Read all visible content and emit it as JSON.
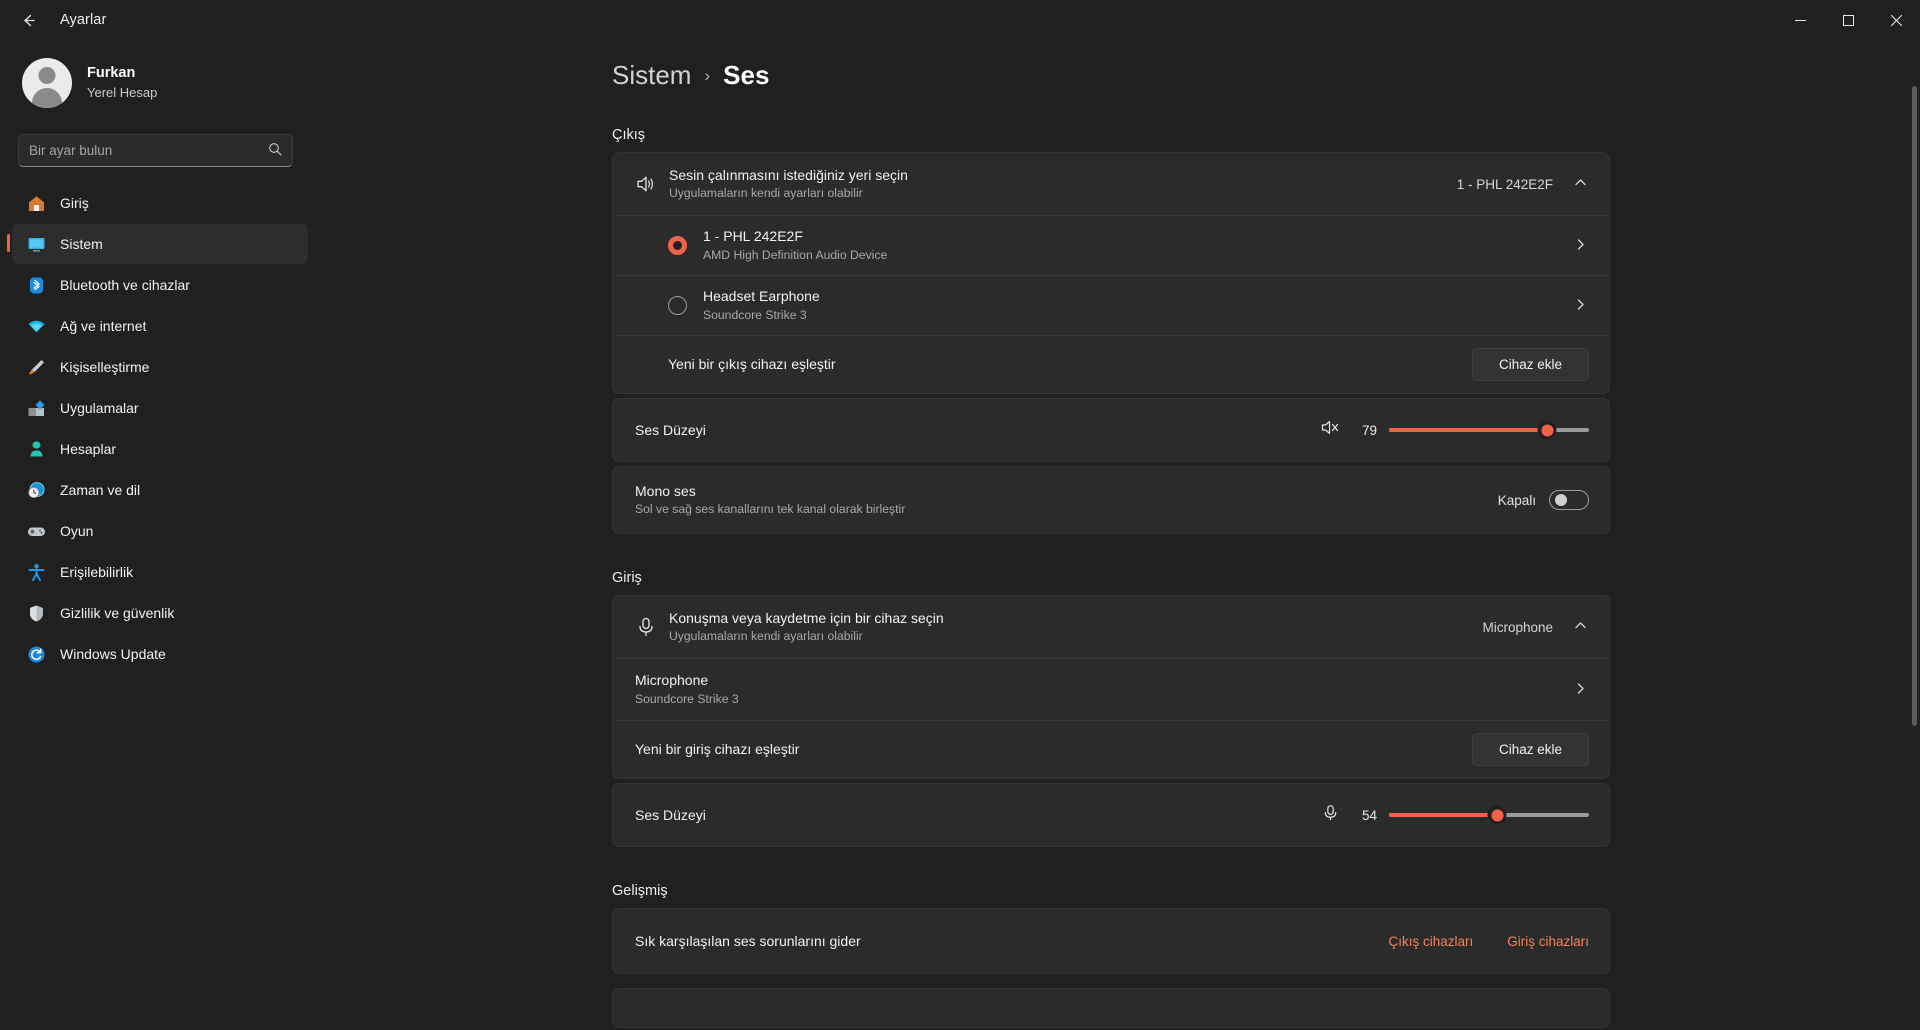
{
  "window": {
    "title": "Ayarlar",
    "back_icon": "back-arrow-icon",
    "minimize": "─",
    "maximize": "☐",
    "close": "✕"
  },
  "account": {
    "name": "Furkan",
    "type": "Yerel Hesap"
  },
  "search": {
    "placeholder": "Bir ayar bulun",
    "value": "",
    "icon": "search-icon"
  },
  "sidebar": {
    "items": [
      {
        "label": "Giriş",
        "icon": "home-icon",
        "active": false
      },
      {
        "label": "Sistem",
        "icon": "system-display-icon",
        "active": true
      },
      {
        "label": "Bluetooth ve cihazlar",
        "icon": "bluetooth-icon",
        "active": false
      },
      {
        "label": "Ağ ve internet",
        "icon": "wifi-icon",
        "active": false
      },
      {
        "label": "Kişiselleştirme",
        "icon": "paintbrush-icon",
        "active": false
      },
      {
        "label": "Uygulamalar",
        "icon": "apps-icon",
        "active": false
      },
      {
        "label": "Hesaplar",
        "icon": "account-person-icon",
        "active": false
      },
      {
        "label": "Zaman ve dil",
        "icon": "clock-globe-icon",
        "active": false
      },
      {
        "label": "Oyun",
        "icon": "gamepad-icon",
        "active": false
      },
      {
        "label": "Erişilebilirlik",
        "icon": "accessibility-person-icon",
        "active": false
      },
      {
        "label": "Gizlilik ve güvenlik",
        "icon": "shield-icon",
        "active": false
      },
      {
        "label": "Windows Update",
        "icon": "update-refresh-icon",
        "active": false
      }
    ]
  },
  "breadcrumb": {
    "parent": "Sistem",
    "separator": "›",
    "current": "Ses"
  },
  "sections": {
    "output": {
      "title": "Çıkış",
      "chooser": {
        "icon": "speaker-icon",
        "title": "Sesin çalınmasını istediğiniz yeri seçin",
        "subtitle": "Uygulamaların kendi ayarları olabilir",
        "value": "1 - PHL 242E2F",
        "chevron": "⌃"
      },
      "devices": [
        {
          "name": "1 - PHL 242E2F",
          "desc": "AMD High Definition Audio Device",
          "selected": true,
          "chevron": "›"
        },
        {
          "name": "Headset Earphone",
          "desc": "Soundcore Strike 3",
          "selected": false,
          "chevron": "›"
        }
      ],
      "pair": {
        "label": "Yeni bir çıkış cihazı eşleştir",
        "button": "Cihaz ekle"
      },
      "volume": {
        "label": "Ses Düzeyi",
        "value": 79,
        "icon": "speaker-muted-icon"
      },
      "mono": {
        "title": "Mono ses",
        "subtitle": "Sol ve sağ ses kanallarını tek kanal olarak birleştir",
        "state_label": "Kapalı",
        "on": false
      }
    },
    "input": {
      "title": "Giriş",
      "chooser": {
        "icon": "microphone-icon",
        "title": "Konuşma veya kaydetme için bir cihaz seçin",
        "subtitle": "Uygulamaların kendi ayarları olabilir",
        "value": "Microphone",
        "chevron": "⌃"
      },
      "devices": [
        {
          "name": "Microphone",
          "desc": "Soundcore Strike 3",
          "chevron": "›"
        }
      ],
      "pair": {
        "label": "Yeni bir giriş cihazı eşleştir",
        "button": "Cihaz ekle"
      },
      "volume": {
        "label": "Ses Düzeyi",
        "value": 54,
        "icon": "microphone-icon"
      }
    },
    "advanced": {
      "title": "Gelişmiş",
      "troubleshoot": {
        "label": "Sık karşılaşılan ses sorunlarını gider",
        "link_output": "Çıkış cihazları",
        "link_input": "Giriş cihazları"
      }
    }
  },
  "colors": {
    "accent": "#f0634a",
    "link": "#f0845a",
    "card": "#2b2b2b",
    "background": "#202020"
  }
}
